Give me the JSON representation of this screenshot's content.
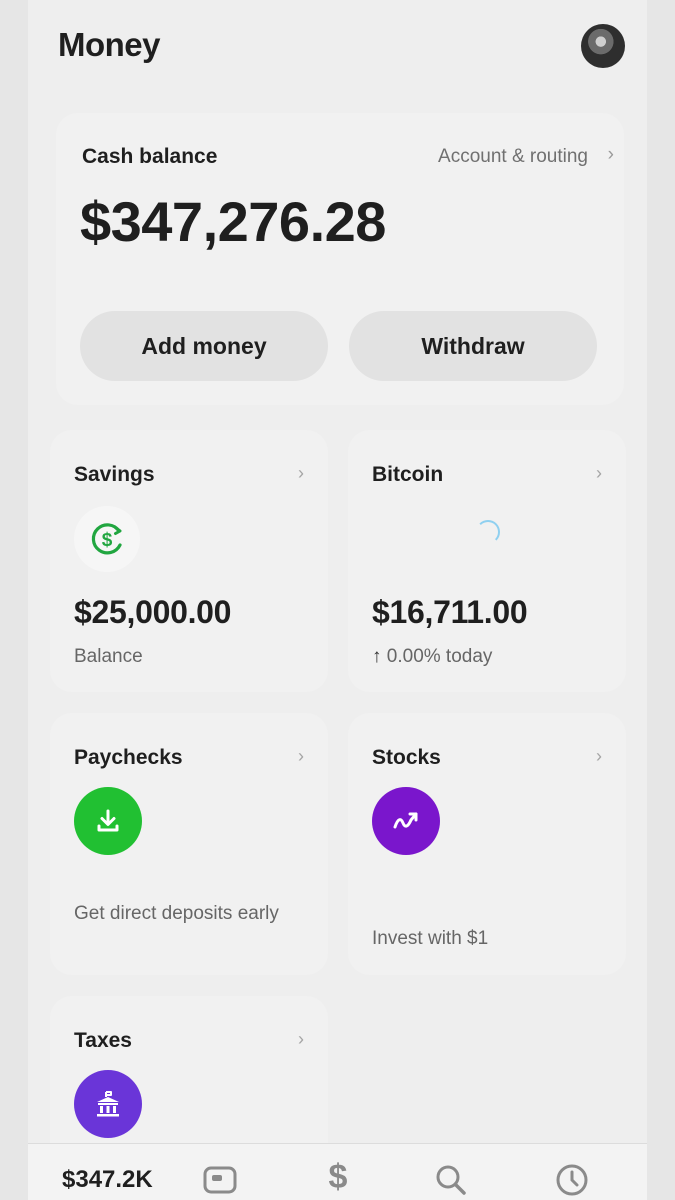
{
  "header": {
    "title": "Money"
  },
  "cash": {
    "label": "Cash balance",
    "account_link": "Account & routing",
    "amount": "$347,276.28",
    "add_money": "Add money",
    "withdraw": "Withdraw"
  },
  "tiles": {
    "savings": {
      "title": "Savings",
      "amount": "$25,000.00",
      "sub": "Balance",
      "icon": "dollar-circle-icon"
    },
    "bitcoin": {
      "title": "Bitcoin",
      "amount": "$16,711.00",
      "change": "0.00% today",
      "icon": "loading-spinner-icon"
    },
    "paychecks": {
      "title": "Paychecks",
      "desc": "Get direct deposits early",
      "icon": "download-icon"
    },
    "stocks": {
      "title": "Stocks",
      "desc": "Invest with $1",
      "icon": "trend-icon"
    },
    "taxes": {
      "title": "Taxes",
      "icon": "government-building-icon"
    }
  },
  "tabbar": {
    "balance": "$347.2K"
  },
  "colors": {
    "green": "#21c032",
    "purple": "#7a16cc",
    "violet": "#6a35d8",
    "background": "#eeeeee"
  }
}
